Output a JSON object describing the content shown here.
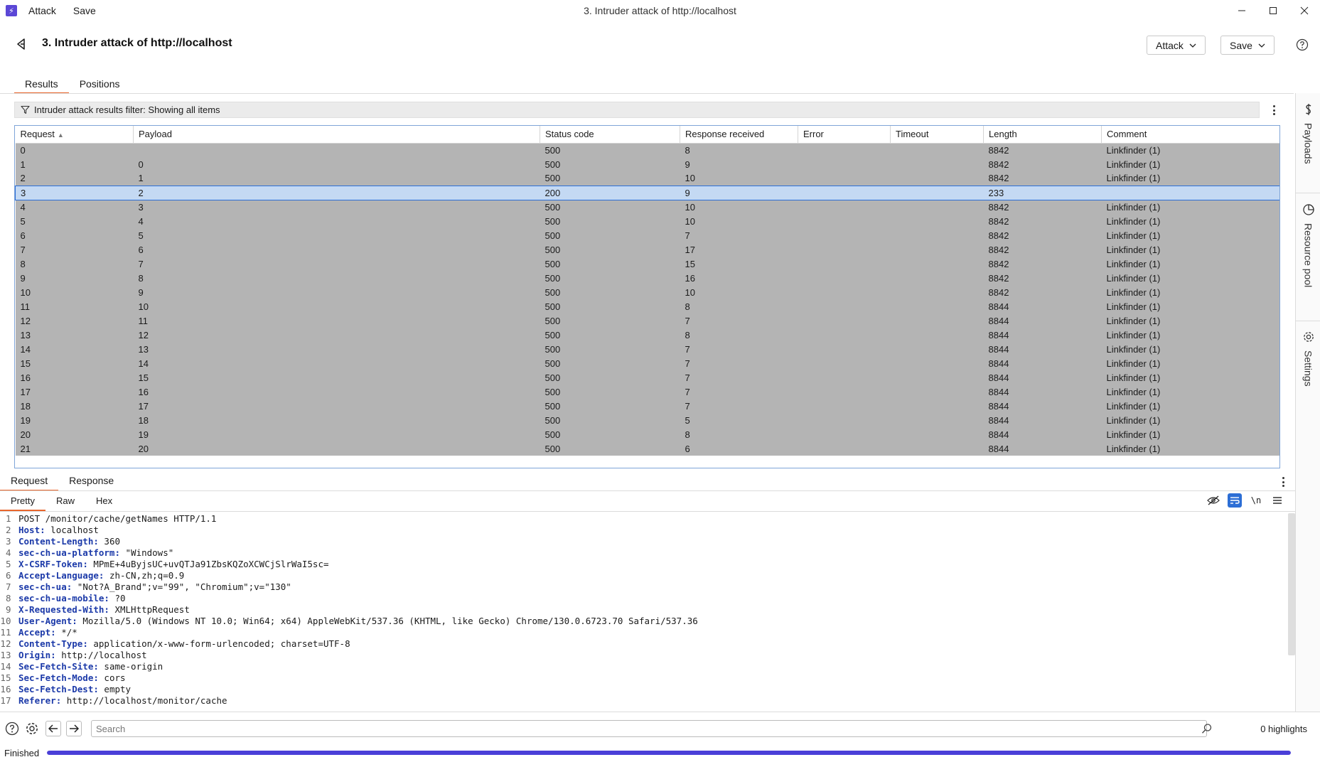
{
  "titlebar": {
    "menu": [
      "Attack",
      "Save"
    ],
    "window_title": "3. Intruder attack of http://localhost"
  },
  "header": {
    "title": "3. Intruder attack of http://localhost",
    "attack_btn": "Attack",
    "save_btn": "Save"
  },
  "tabs": [
    {
      "label": "Results",
      "active": true
    },
    {
      "label": "Positions",
      "active": false
    }
  ],
  "side_panels": [
    "Payloads",
    "Resource pool",
    "Settings"
  ],
  "filter": {
    "text": "Intruder attack results filter: Showing all items"
  },
  "table": {
    "columns": [
      "Request",
      "Payload",
      "Status code",
      "Response received",
      "Error",
      "Timeout",
      "Length",
      "Comment"
    ],
    "sorted_column": "Request",
    "selected_row": 3,
    "rows": [
      [
        "0",
        "",
        "500",
        "8",
        "",
        "",
        "8842",
        "Linkfinder (1)"
      ],
      [
        "1",
        "0",
        "500",
        "9",
        "",
        "",
        "8842",
        "Linkfinder (1)"
      ],
      [
        "2",
        "1",
        "500",
        "10",
        "",
        "",
        "8842",
        "Linkfinder (1)"
      ],
      [
        "3",
        "2",
        "200",
        "9",
        "",
        "",
        "233",
        ""
      ],
      [
        "4",
        "3",
        "500",
        "10",
        "",
        "",
        "8842",
        "Linkfinder (1)"
      ],
      [
        "5",
        "4",
        "500",
        "10",
        "",
        "",
        "8842",
        "Linkfinder (1)"
      ],
      [
        "6",
        "5",
        "500",
        "7",
        "",
        "",
        "8842",
        "Linkfinder (1)"
      ],
      [
        "7",
        "6",
        "500",
        "17",
        "",
        "",
        "8842",
        "Linkfinder (1)"
      ],
      [
        "8",
        "7",
        "500",
        "15",
        "",
        "",
        "8842",
        "Linkfinder (1)"
      ],
      [
        "9",
        "8",
        "500",
        "16",
        "",
        "",
        "8842",
        "Linkfinder (1)"
      ],
      [
        "10",
        "9",
        "500",
        "10",
        "",
        "",
        "8842",
        "Linkfinder (1)"
      ],
      [
        "11",
        "10",
        "500",
        "8",
        "",
        "",
        "8844",
        "Linkfinder (1)"
      ],
      [
        "12",
        "11",
        "500",
        "7",
        "",
        "",
        "8844",
        "Linkfinder (1)"
      ],
      [
        "13",
        "12",
        "500",
        "8",
        "",
        "",
        "8844",
        "Linkfinder (1)"
      ],
      [
        "14",
        "13",
        "500",
        "7",
        "",
        "",
        "8844",
        "Linkfinder (1)"
      ],
      [
        "15",
        "14",
        "500",
        "7",
        "",
        "",
        "8844",
        "Linkfinder (1)"
      ],
      [
        "16",
        "15",
        "500",
        "7",
        "",
        "",
        "8844",
        "Linkfinder (1)"
      ],
      [
        "17",
        "16",
        "500",
        "7",
        "",
        "",
        "8844",
        "Linkfinder (1)"
      ],
      [
        "18",
        "17",
        "500",
        "7",
        "",
        "",
        "8844",
        "Linkfinder (1)"
      ],
      [
        "19",
        "18",
        "500",
        "5",
        "",
        "",
        "8844",
        "Linkfinder (1)"
      ],
      [
        "20",
        "19",
        "500",
        "8",
        "",
        "",
        "8844",
        "Linkfinder (1)"
      ],
      [
        "21",
        "20",
        "500",
        "6",
        "",
        "",
        "8844",
        "Linkfinder (1)"
      ]
    ]
  },
  "lower_tabs": [
    {
      "label": "Request",
      "active": true
    },
    {
      "label": "Response",
      "active": false
    }
  ],
  "view_tabs": [
    {
      "label": "Pretty",
      "active": true
    },
    {
      "label": "Raw",
      "active": false
    },
    {
      "label": "Hex",
      "active": false
    }
  ],
  "toolbar_icons": [
    "hide-icon",
    "wrap-icon",
    "newline-icon",
    "menu-icon"
  ],
  "newline_glyph": "\\n",
  "request_lines": [
    {
      "key": "",
      "value": "POST /monitor/cache/getNames HTTP/1.1"
    },
    {
      "key": "Host",
      "value": "localhost"
    },
    {
      "key": "Content-Length",
      "value": "360"
    },
    {
      "key": "sec-ch-ua-platform",
      "value": "\"Windows\""
    },
    {
      "key": "X-CSRF-Token",
      "value": "MPmE+4uByjsUC+uvQTJa91ZbsKQZoXCWCjSlrWaI5sc="
    },
    {
      "key": "Accept-Language",
      "value": "zh-CN,zh;q=0.9"
    },
    {
      "key": "sec-ch-ua",
      "value": "\"Not?A_Brand\";v=\"99\", \"Chromium\";v=\"130\""
    },
    {
      "key": "sec-ch-ua-mobile",
      "value": "?0"
    },
    {
      "key": "X-Requested-With",
      "value": "XMLHttpRequest"
    },
    {
      "key": "User-Agent",
      "value": "Mozilla/5.0 (Windows NT 10.0; Win64; x64) AppleWebKit/537.36 (KHTML, like Gecko) Chrome/130.0.6723.70 Safari/537.36"
    },
    {
      "key": "Accept",
      "value": "*/*"
    },
    {
      "key": "Content-Type",
      "value": "application/x-www-form-urlencoded; charset=UTF-8"
    },
    {
      "key": "Origin",
      "value": "http://localhost"
    },
    {
      "key": "Sec-Fetch-Site",
      "value": "same-origin"
    },
    {
      "key": "Sec-Fetch-Mode",
      "value": "cors"
    },
    {
      "key": "Sec-Fetch-Dest",
      "value": "empty"
    },
    {
      "key": "Referer",
      "value": "http://localhost/monitor/cache"
    }
  ],
  "search": {
    "placeholder": "Search",
    "highlights": "0 highlights"
  },
  "status": {
    "text": "Finished",
    "progress": 1.0
  },
  "colors": {
    "accent": "#e8662c",
    "selection": "#c4d9f3",
    "row_bg": "#b4b4b4",
    "progress": "#4a3fd8",
    "header_key": "#1c3aa9"
  }
}
